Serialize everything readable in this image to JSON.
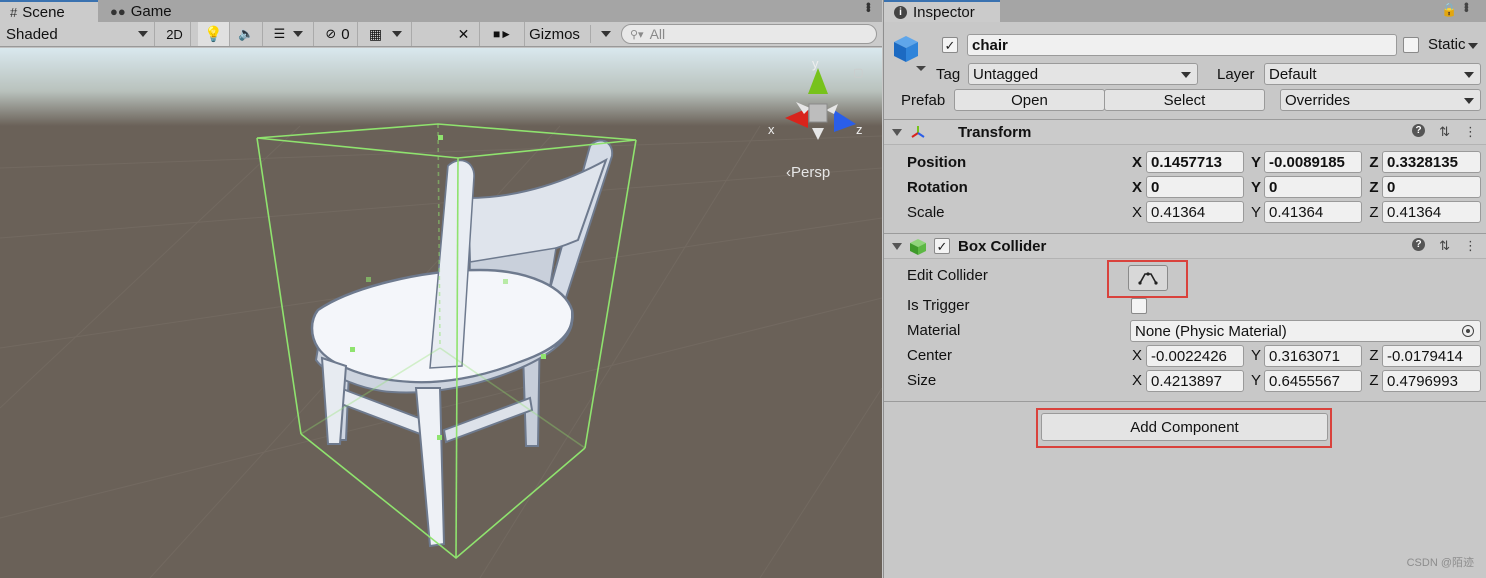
{
  "scene": {
    "tabs": [
      {
        "label": "Scene",
        "icon": "grid-icon"
      },
      {
        "label": "Game",
        "icon": "gamepad-icon"
      }
    ],
    "toolbar": {
      "shading_mode": "Shaded",
      "toggle_2d": "2D",
      "hidden_count": "0",
      "gizmos": "Gizmos",
      "search_placeholder": "All"
    },
    "view": {
      "projection_label": "Persp",
      "axes": {
        "x": "x",
        "y": "y",
        "z": "z"
      },
      "colors": {
        "background_top": "#d9e8ee",
        "ground": "#6a6158",
        "bounds": "#8fe36e",
        "chair": "#f2f4f8",
        "x_axis": "#d8241c",
        "y_axis": "#77c21b",
        "z_axis": "#2a5ee8"
      }
    }
  },
  "inspector": {
    "tab_label": "Inspector",
    "object": {
      "active": true,
      "name": "chair",
      "static_label": "Static",
      "tag_label": "Tag",
      "tag_value": "Untagged",
      "layer_label": "Layer",
      "layer_value": "Default",
      "prefab_label": "Prefab",
      "prefab_open": "Open",
      "prefab_select": "Select",
      "prefab_overrides": "Overrides"
    },
    "transform": {
      "title": "Transform",
      "rows": [
        {
          "label": "Position",
          "x": "0.1457713",
          "y": "-0.0089185",
          "z": "0.3328135"
        },
        {
          "label": "Rotation",
          "x": "0",
          "y": "0",
          "z": "0"
        },
        {
          "label": "Scale",
          "x": "0.41364",
          "y": "0.41364",
          "z": "0.41364"
        }
      ]
    },
    "box_collider": {
      "title": "Box Collider",
      "enabled": true,
      "edit_collider_label": "Edit Collider",
      "is_trigger_label": "Is Trigger",
      "material_label": "Material",
      "material_value": "None (Physic Material)",
      "center_label": "Center",
      "center": {
        "x": "-0.0022426",
        "y": "0.3163071",
        "z": "-0.0179414"
      },
      "size_label": "Size",
      "size": {
        "x": "0.4213897",
        "y": "0.6455567",
        "z": "0.4796993"
      }
    },
    "add_component_label": "Add Component",
    "axis_labels": {
      "x": "X",
      "y": "Y",
      "z": "Z"
    },
    "highlight_color": "#d9423c"
  },
  "watermark": "CSDN @陌迹"
}
